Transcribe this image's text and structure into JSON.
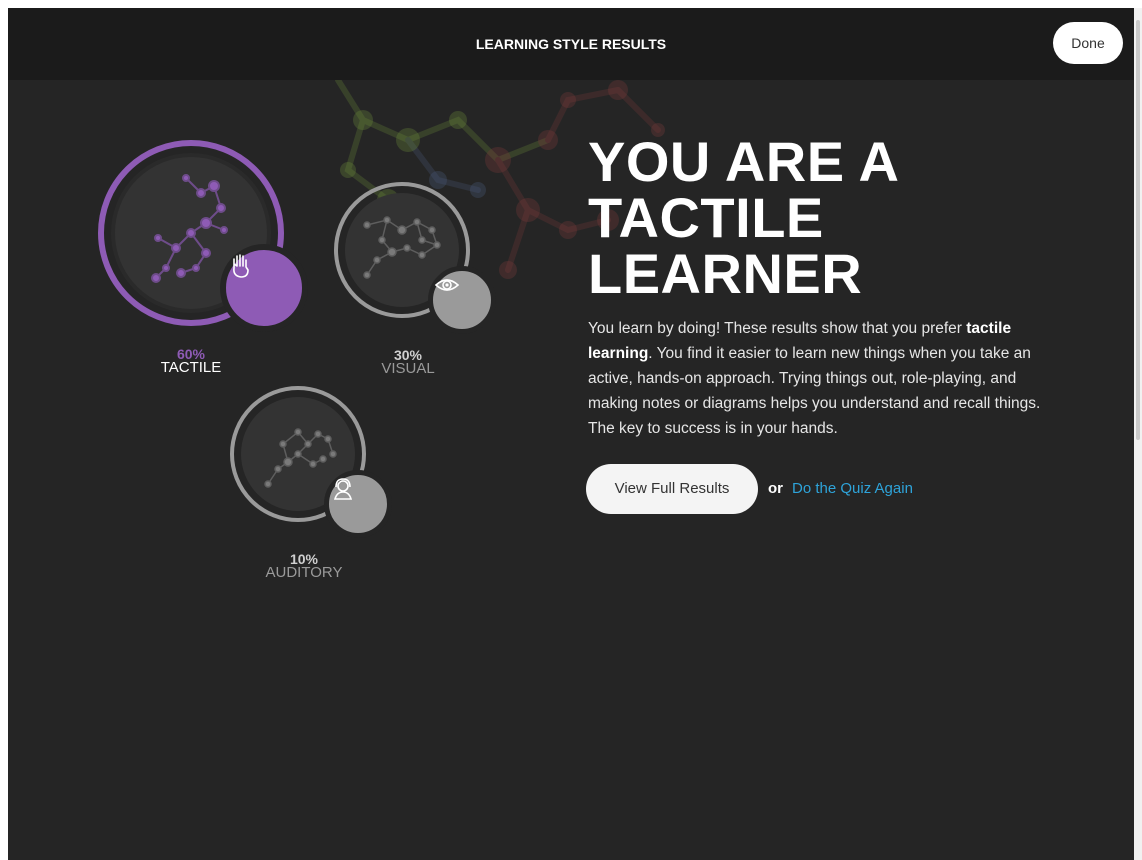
{
  "header": {
    "title": "LEARNING STYLE RESULTS",
    "done_label": "Done"
  },
  "results": [
    {
      "key": "tactile",
      "percent": "60%",
      "label": "TACTILE",
      "value": 0.6,
      "accent": "#8e5bb5",
      "icon": "hand-icon"
    },
    {
      "key": "visual",
      "percent": "30%",
      "label": "VISUAL",
      "value": 0.3,
      "accent": "#9a9a9a",
      "icon": "eye-icon"
    },
    {
      "key": "auditory",
      "percent": "10%",
      "label": "AUDITORY",
      "value": 0.1,
      "accent": "#9a9a9a",
      "icon": "headphones-icon"
    }
  ],
  "hero": {
    "line1": "YOU ARE A",
    "line2": "TACTILE",
    "line3": "LEARNER"
  },
  "description": {
    "part1": "You learn by doing! These results show that you prefer ",
    "bold": "tactile learning",
    "part2": ". You find it easier to learn new things when you take an active, hands-on approach. Trying things out, role-playing, and making notes or diagrams helps you understand and recall things. The key to success is in your hands."
  },
  "actions": {
    "view_full_results": "View Full Results",
    "or": "or",
    "quiz_again": "Do the Quiz Again"
  },
  "colors": {
    "background": "#252525",
    "header": "#1b1b1b",
    "tactile_accent": "#8e5bb5",
    "link": "#2ea3d9"
  }
}
